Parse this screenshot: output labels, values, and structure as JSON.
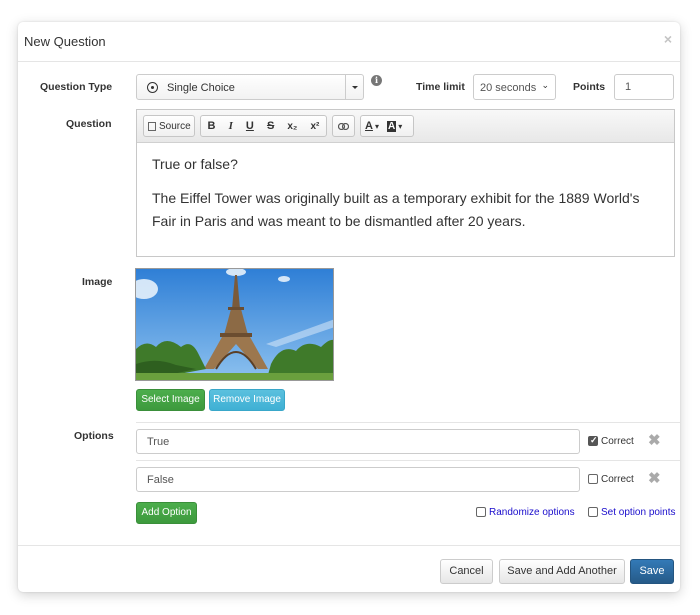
{
  "modal": {
    "title": "New Question",
    "close_label": "×"
  },
  "form": {
    "question_type": {
      "label": "Question Type",
      "value": "Single Choice",
      "icon": "radio-icon"
    },
    "info_icon": "i",
    "time_limit": {
      "label": "Time limit",
      "value": "20 seconds"
    },
    "points": {
      "label": "Points",
      "value": "1"
    },
    "question": {
      "label": "Question",
      "toolbar": {
        "source": "Source",
        "bold": "B",
        "italic": "I",
        "underline": "U",
        "strike": "S",
        "subscript": "x₂",
        "superscript": "x²",
        "link": "link-icon",
        "text_color": "A",
        "bg_color": "A"
      },
      "paragraphs": [
        "True or false?",
        "The Eiffel Tower was originally built as a temporary exhibit for the 1889 World's Fair in Paris and was meant to be dismantled after 20 years."
      ]
    },
    "image": {
      "label": "Image",
      "alt": "Eiffel Tower",
      "select_button": "Select Image",
      "remove_button": "Remove Image"
    },
    "options": {
      "label": "Options",
      "items": [
        {
          "value": "True",
          "correct": true,
          "correct_label": "Correct"
        },
        {
          "value": "False",
          "correct": false,
          "correct_label": "Correct"
        }
      ],
      "add_button": "Add Option",
      "randomize_label": "Randomize options",
      "set_points_label": "Set option points"
    }
  },
  "footer": {
    "cancel": "Cancel",
    "save_add_another": "Save and Add Another",
    "save": "Save"
  },
  "colors": {
    "primary": "#286090",
    "success": "#449d44",
    "info": "#5bc0de",
    "link": "#1a0dcc"
  }
}
